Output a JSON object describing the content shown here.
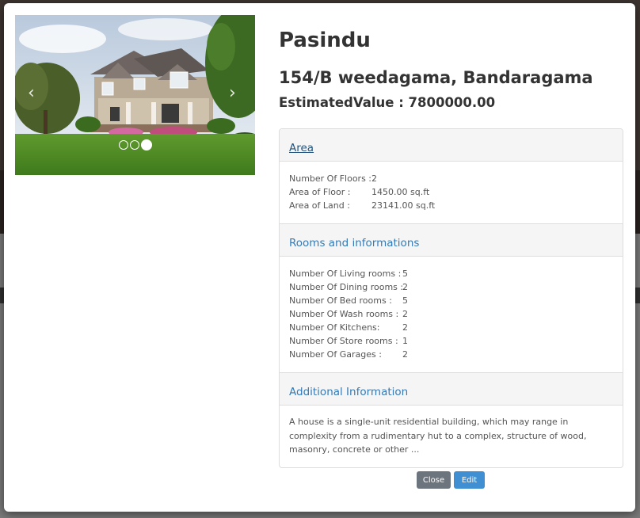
{
  "property": {
    "owner": "Pasindu",
    "address": "154/B weedagama, Bandaragama",
    "estimated_value": "EstimatedValue : 7800000.00"
  },
  "carousel": {
    "prev_icon": "chevron-left-icon",
    "next_icon": "chevron-right-icon",
    "prev_glyph": "‹",
    "next_glyph": "›",
    "slides": 3,
    "active_slide": 3
  },
  "area": {
    "title": "Area",
    "rows": [
      {
        "label": "Number Of Floors :",
        "value": "2"
      },
      {
        "label": "Area of Floor :",
        "value": "1450.00 sq.ft"
      },
      {
        "label": "Area of Land :",
        "value": "23141.00 sq.ft"
      }
    ]
  },
  "rooms": {
    "title": "Rooms and informations",
    "rows": [
      {
        "label": "Number Of Living rooms :",
        "value": "5"
      },
      {
        "label": "Number Of Dining rooms :",
        "value": "2"
      },
      {
        "label": "Number Of Bed rooms :",
        "value": "5"
      },
      {
        "label": "Number Of Wash rooms :",
        "value": "2"
      },
      {
        "label": "Number Of Kitchens:",
        "value": "2"
      },
      {
        "label": "Number Of Store rooms :",
        "value": "1"
      },
      {
        "label": "Number Of Garages :",
        "value": "2"
      }
    ]
  },
  "additional": {
    "title": "Additional Information",
    "description": "A house is a single-unit residential building, which may range in complexity from a rudimentary hut to a complex, structure of wood, masonry, concrete or other ..."
  },
  "buttons": {
    "close": "Close",
    "edit": "Edit"
  },
  "colors": {
    "primary": "#337ab7",
    "edit_button": "#3f8fd2",
    "close_button": "#6c757d"
  }
}
